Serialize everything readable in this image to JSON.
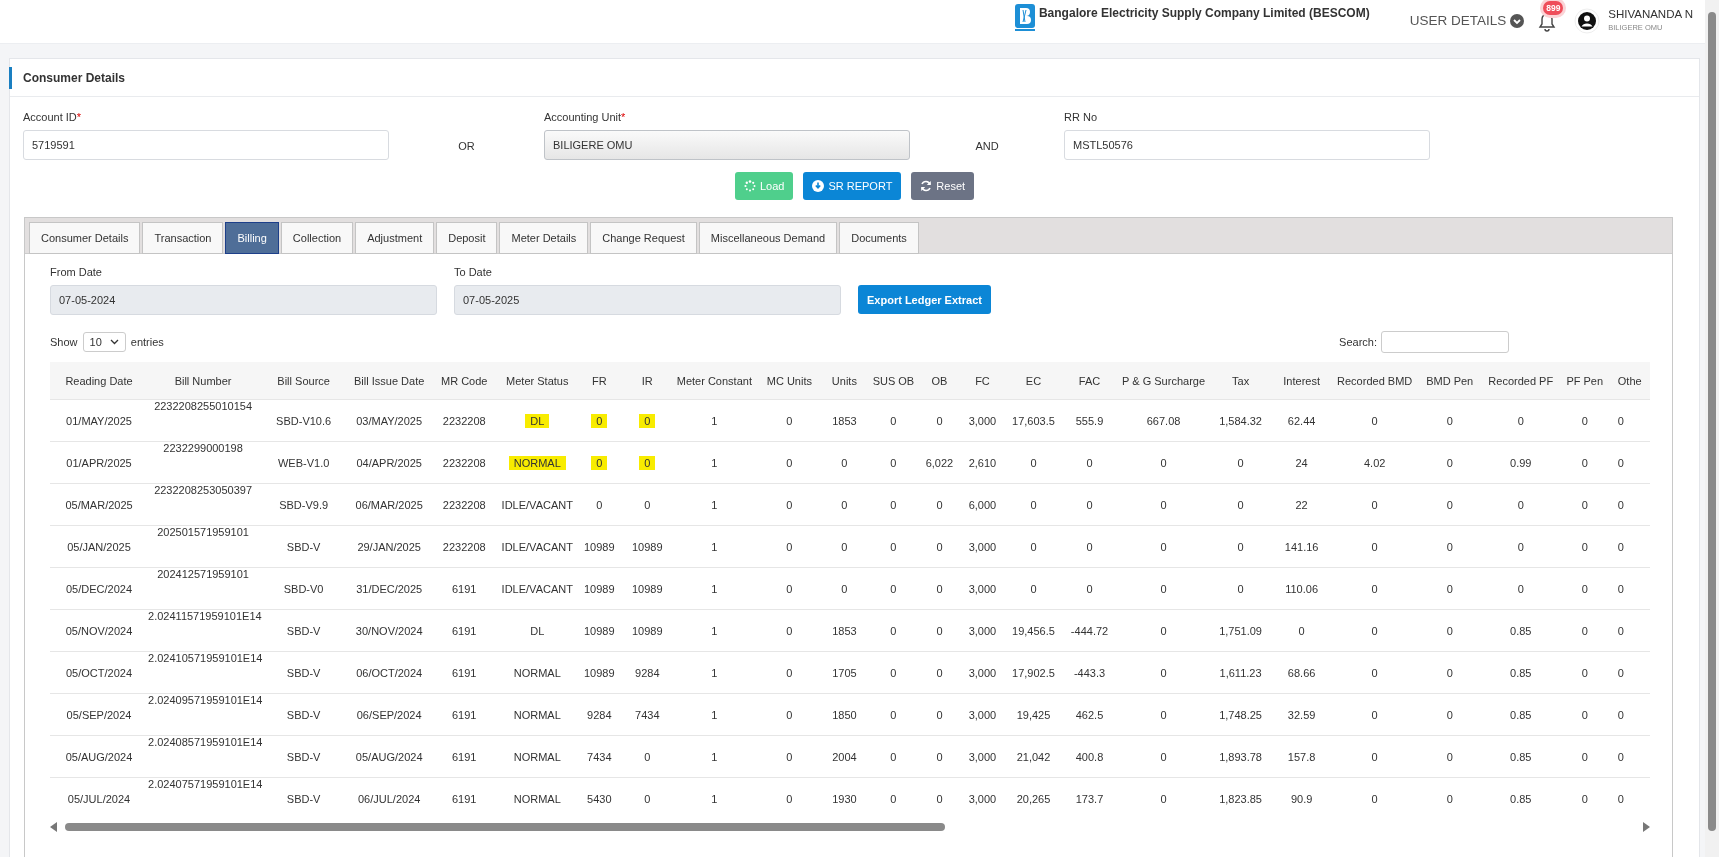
{
  "header": {
    "company": "Bangalore Electricity Supply Company Limited (BESCOM)",
    "user_menu": "USER DETAILS",
    "notification_count": "899",
    "user_name": "SHIVANANDA N",
    "user_unit": "BILIGERE OMU"
  },
  "card": {
    "title": "Consumer Details"
  },
  "search_form": {
    "fields": [
      {
        "label": "Account ID",
        "required_mark": "*",
        "value": "5719591",
        "disabled": false
      },
      {
        "label": "Accounting Unit",
        "required_mark": "*",
        "value": "BILIGERE OMU",
        "disabled": true
      },
      {
        "label": "RR No",
        "value": "MSTL50576",
        "disabled": false
      }
    ],
    "connectors": [
      "OR",
      "AND"
    ],
    "buttons": [
      {
        "label": "Load",
        "kind": "success"
      },
      {
        "label": "SR REPORT",
        "kind": "primary"
      },
      {
        "label": "Reset",
        "kind": "secondary"
      }
    ]
  },
  "tabs": [
    {
      "label": "Consumer Details",
      "selected": false
    },
    {
      "label": "Transaction",
      "selected": false
    },
    {
      "label": "Billing",
      "selected": true
    },
    {
      "label": "Collection",
      "selected": false
    },
    {
      "label": "Adjustment",
      "selected": false
    },
    {
      "label": "Deposit",
      "selected": false
    },
    {
      "label": "Meter Details",
      "selected": false
    },
    {
      "label": "Change Request",
      "selected": false
    },
    {
      "label": "Miscellaneous Demand",
      "selected": false
    },
    {
      "label": "Documents",
      "selected": false
    }
  ],
  "billing": {
    "date_fields": [
      {
        "label": "From Date",
        "value": "07-05-2024"
      },
      {
        "label": "To Date",
        "value": "07-05-2025"
      }
    ],
    "export_button": "Export Ledger Extract"
  },
  "table": {
    "show_label": "Show",
    "page_size": "10",
    "entries_label": "entries",
    "search_label": "Search:",
    "columns": [
      "Reading Date",
      "Bill Number",
      "Bill Source",
      "Bill Issue Date",
      "MR Code",
      "Meter Status",
      "FR",
      "IR",
      "Meter Constant",
      "MC Units",
      "Units",
      "SUS OB",
      "OB",
      "FC",
      "EC",
      "FAC",
      "P & G Surcharge",
      "Tax",
      "Interest",
      "Recorded BMD",
      "BMD Pen",
      "Recorded PF",
      "PF Pen",
      "Othe"
    ],
    "rows": [
      [
        "01/MAY/2025",
        "2232208255010154",
        "SBD-V10.6",
        "03/MAY/2025",
        "2232208",
        {
          "text": "DL",
          "highlighted": true
        },
        {
          "text": "0",
          "highlighted": true
        },
        {
          "text": "0",
          "highlighted": true
        },
        "1",
        "0",
        "1853",
        "0",
        "0",
        "3,000",
        "17,603.5",
        "555.9",
        "667.08",
        "1,584.32",
        "62.44",
        "0",
        "0",
        "0",
        "0",
        "0"
      ],
      [
        "01/APR/2025",
        "2232299000198",
        "WEB-V1.0",
        "04/APR/2025",
        "2232208",
        {
          "text": "NORMAL",
          "highlighted": true
        },
        {
          "text": "0",
          "highlighted": true
        },
        {
          "text": "0",
          "highlighted": true
        },
        "1",
        "0",
        "0",
        "0",
        "6,022",
        "2,610",
        "0",
        "0",
        "0",
        "0",
        "24",
        "4.02",
        "0",
        "0.99",
        "0",
        "0"
      ],
      [
        "05/MAR/2025",
        "2232208253050397",
        "SBD-V9.9",
        "06/MAR/2025",
        "2232208",
        "IDLE/VACANT",
        "0",
        "0",
        "1",
        "0",
        "0",
        "0",
        "0",
        "6,000",
        "0",
        "0",
        "0",
        "0",
        "22",
        "0",
        "0",
        "0",
        "0",
        "0"
      ],
      [
        "05/JAN/2025",
        "202501571959101",
        "SBD-V",
        "29/JAN/2025",
        "2232208",
        "IDLE/VACANT",
        "10989",
        "10989",
        "1",
        "0",
        "0",
        "0",
        "0",
        "3,000",
        "0",
        "0",
        "0",
        "0",
        "141.16",
        "0",
        "0",
        "0",
        "0",
        "0"
      ],
      [
        "05/DEC/2024",
        "202412571959101",
        "SBD-V0",
        "31/DEC/2025",
        "6191",
        "IDLE/VACANT",
        "10989",
        "10989",
        "1",
        "0",
        "0",
        "0",
        "0",
        "3,000",
        "0",
        "0",
        "0",
        "0",
        "110.06",
        "0",
        "0",
        "0",
        "0",
        "0"
      ],
      [
        "05/NOV/2024",
        "2.02411571959101E14",
        "SBD-V",
        "30/NOV/2024",
        "6191",
        "DL",
        "10989",
        "10989",
        "1",
        "0",
        "1853",
        "0",
        "0",
        "3,000",
        "19,456.5",
        "-444.72",
        "0",
        "1,751.09",
        "0",
        "0",
        "0",
        "0.85",
        "0",
        "0"
      ],
      [
        "05/OCT/2024",
        "2.02410571959101E14",
        "SBD-V",
        "06/OCT/2024",
        "6191",
        "NORMAL",
        "10989",
        "9284",
        "1",
        "0",
        "1705",
        "0",
        "0",
        "3,000",
        "17,902.5",
        "-443.3",
        "0",
        "1,611.23",
        "68.66",
        "0",
        "0",
        "0.85",
        "0",
        "0"
      ],
      [
        "05/SEP/2024",
        "2.02409571959101E14",
        "SBD-V",
        "06/SEP/2024",
        "6191",
        "NORMAL",
        "9284",
        "7434",
        "1",
        "0",
        "1850",
        "0",
        "0",
        "3,000",
        "19,425",
        "462.5",
        "0",
        "1,748.25",
        "32.59",
        "0",
        "0",
        "0.85",
        "0",
        "0"
      ],
      [
        "05/AUG/2024",
        "2.02408571959101E14",
        "SBD-V",
        "05/AUG/2024",
        "6191",
        "NORMAL",
        "7434",
        "0",
        "1",
        "0",
        "2004",
        "0",
        "0",
        "3,000",
        "21,042",
        "400.8",
        "0",
        "1,893.78",
        "157.8",
        "0",
        "0",
        "0.85",
        "0",
        "0"
      ],
      [
        "05/JUL/2024",
        "2.02407571959101E14",
        "SBD-V",
        "06/JUL/2024",
        "6191",
        "NORMAL",
        "5430",
        "0",
        "1",
        "0",
        "1930",
        "0",
        "0",
        "3,000",
        "20,265",
        "173.7",
        "0",
        "1,823.85",
        "90.9",
        "0",
        "0",
        "0.85",
        "0",
        "0"
      ]
    ]
  }
}
